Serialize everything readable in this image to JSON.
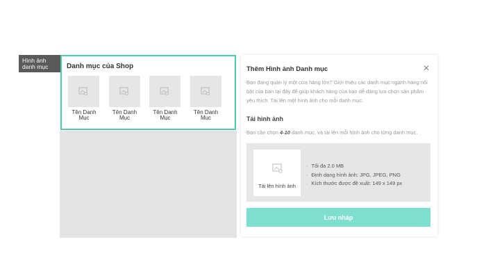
{
  "side_label": {
    "line1": "Hình ảnh",
    "line2": "danh mục"
  },
  "shop_panel": {
    "title": "Danh mục của Shop",
    "categories": [
      {
        "line1": "Tên Danh",
        "line2": "Mục",
        "icon": "image-placeholder-icon"
      },
      {
        "line1": "Tên Danh",
        "line2": "Mục",
        "icon": "image-placeholder-icon"
      },
      {
        "line1": "Tên Danh",
        "line2": "Mục",
        "icon": "image-placeholder-icon"
      },
      {
        "line1": "Tên Danh",
        "line2": "Mục",
        "icon": "image-placeholder-icon"
      }
    ]
  },
  "modal": {
    "title": "Thêm Hình ảnh Danh mục",
    "close": "✕",
    "description": "Bạn đang quản lý một cửa hàng lớn? Giới thiệu các danh mục ngành hàng nổi bật của bạn tại đây để giúp khách hàng của bạn dễ dàng lựa chọn sản phẩm yêu thích. Tải lên một hình ảnh cho mỗi danh mục.",
    "upload_heading": "Tải hình ảnh",
    "hint_before": "Bạn cần chọn ",
    "hint_range": "4-10",
    "hint_after": " danh mục, và tải lên mỗi hình ảnh cho từng danh mục.",
    "upload_card_label": "Tải lên hình ảnh",
    "requirements": [
      "Tối đa 2.0 MB",
      "Định dạng hình ảnh: JPG, JPEG, PNG",
      "Kích thước được đề xuất: 149 x 149 px"
    ],
    "save_label": "Lưu nháp"
  },
  "colors": {
    "accent_border": "#52c9a8",
    "save_button": "#7fdfcf",
    "side_label_bg": "#5a5a5a"
  }
}
